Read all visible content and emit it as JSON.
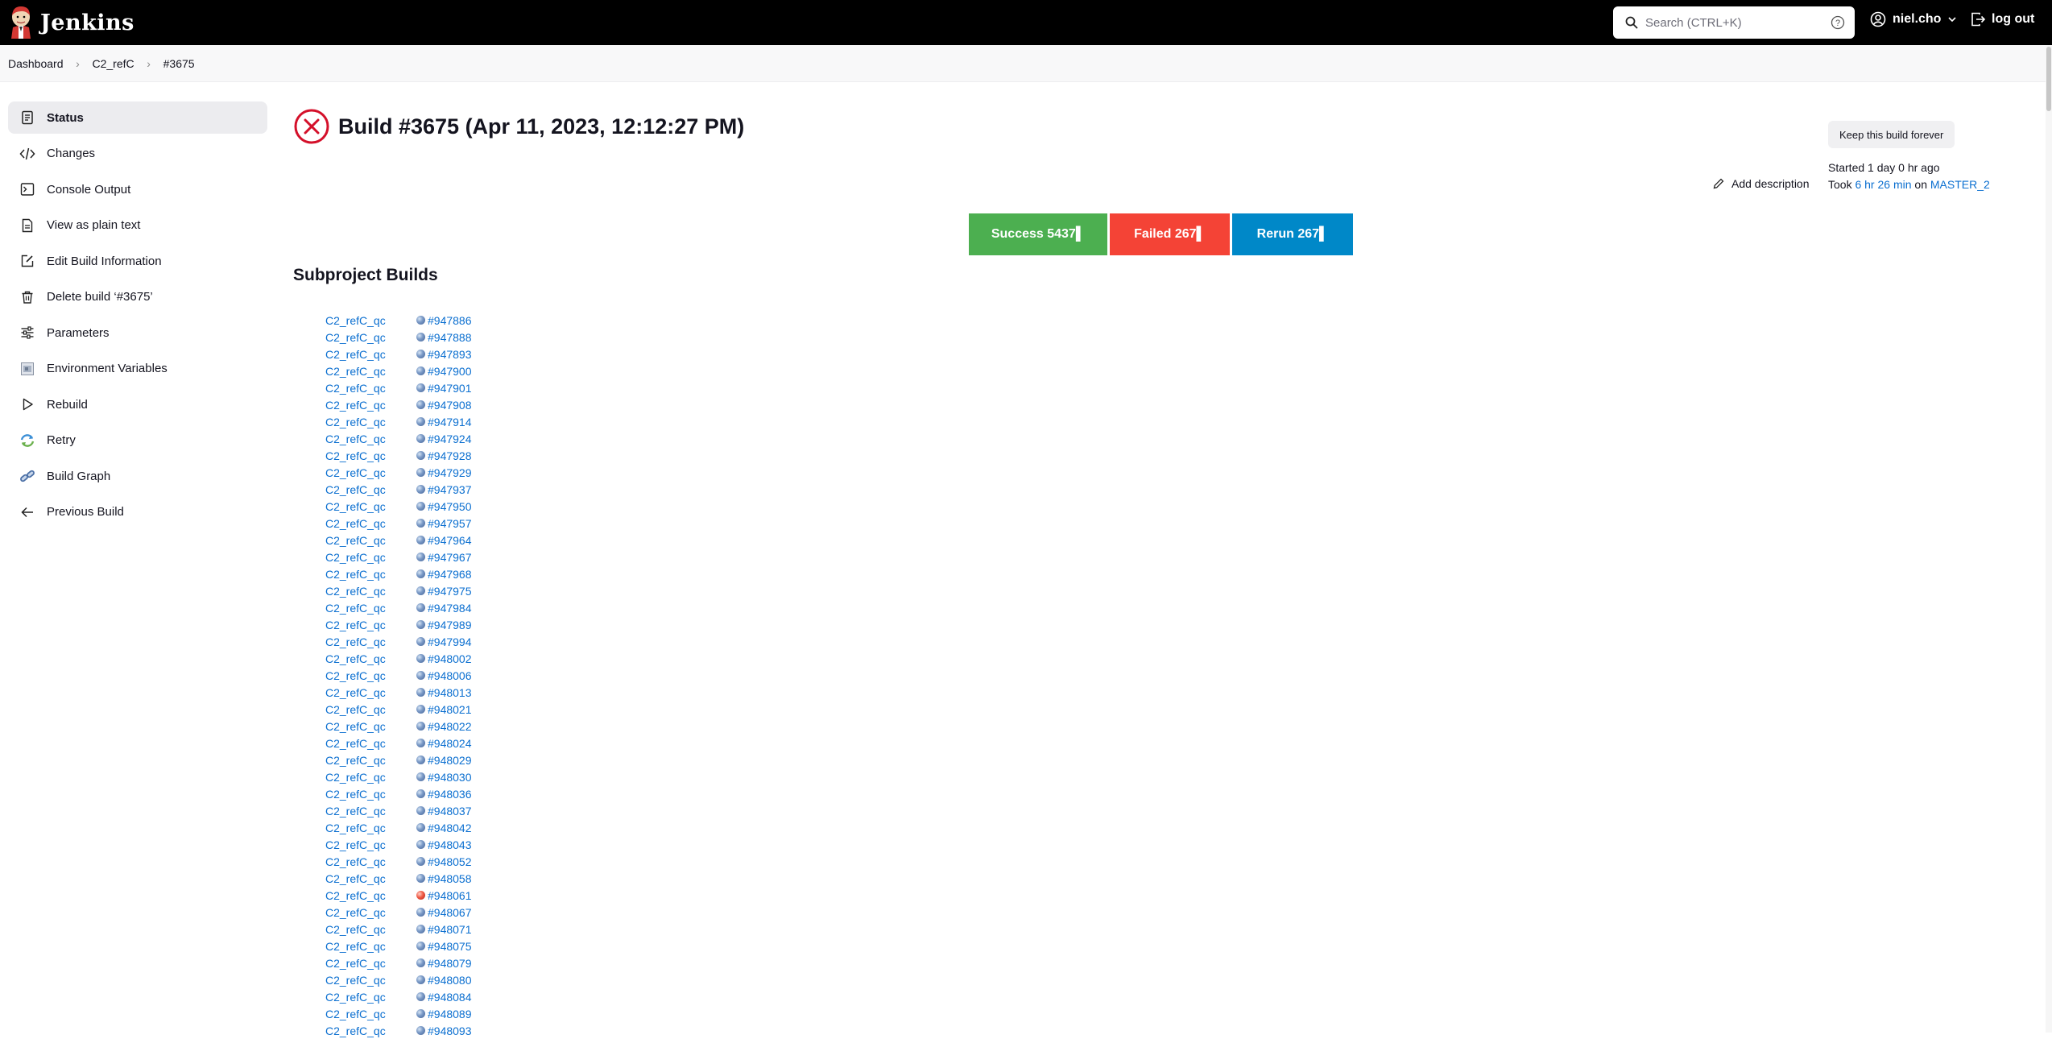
{
  "header": {
    "app_name": "Jenkins",
    "search_placeholder": "Search (CTRL+K)",
    "user_name": "niel.cho",
    "logout_label": "log out"
  },
  "breadcrumb": [
    "Dashboard",
    "C2_refC",
    "#3675"
  ],
  "sidebar": {
    "items": [
      {
        "label": "Status",
        "icon": "status-doc-icon",
        "active": true
      },
      {
        "label": "Changes",
        "icon": "code-icon"
      },
      {
        "label": "Console Output",
        "icon": "terminal-icon"
      },
      {
        "label": "View as plain text",
        "icon": "document-icon"
      },
      {
        "label": "Edit Build Information",
        "icon": "edit-icon"
      },
      {
        "label": "Delete build ‘#3675’",
        "icon": "trash-icon"
      },
      {
        "label": "Parameters",
        "icon": "sliders-icon"
      },
      {
        "label": "Environment Variables",
        "icon": "env-vars-icon"
      },
      {
        "label": "Rebuild",
        "icon": "play-icon"
      },
      {
        "label": "Retry",
        "icon": "retry-icon"
      },
      {
        "label": "Build Graph",
        "icon": "link-icon"
      },
      {
        "label": "Previous Build",
        "icon": "arrow-left-icon"
      }
    ]
  },
  "build": {
    "title": "Build #3675 (Apr 11, 2023, 12:12:27 PM)",
    "keep_label": "Keep this build forever",
    "started": "Started 1 day 0 hr ago",
    "took_prefix": "Took ",
    "duration": "6 hr 26 min",
    "on_word": " on ",
    "node": "MASTER_2",
    "add_description": "Add description"
  },
  "summary": {
    "success": "Success 5437▌",
    "failed": "Failed 267▌",
    "rerun": "Rerun 267▌"
  },
  "subprojects": {
    "title": "Subproject Builds",
    "rows": [
      {
        "job": "C2_refC_qc",
        "build": "#947886",
        "status": "blue"
      },
      {
        "job": "C2_refC_qc",
        "build": "#947888",
        "status": "blue"
      },
      {
        "job": "C2_refC_qc",
        "build": "#947893",
        "status": "blue"
      },
      {
        "job": "C2_refC_qc",
        "build": "#947900",
        "status": "blue"
      },
      {
        "job": "C2_refC_qc",
        "build": "#947901",
        "status": "blue"
      },
      {
        "job": "C2_refC_qc",
        "build": "#947908",
        "status": "blue"
      },
      {
        "job": "C2_refC_qc",
        "build": "#947914",
        "status": "blue"
      },
      {
        "job": "C2_refC_qc",
        "build": "#947924",
        "status": "blue"
      },
      {
        "job": "C2_refC_qc",
        "build": "#947928",
        "status": "blue"
      },
      {
        "job": "C2_refC_qc",
        "build": "#947929",
        "status": "blue"
      },
      {
        "job": "C2_refC_qc",
        "build": "#947937",
        "status": "blue"
      },
      {
        "job": "C2_refC_qc",
        "build": "#947950",
        "status": "blue"
      },
      {
        "job": "C2_refC_qc",
        "build": "#947957",
        "status": "blue"
      },
      {
        "job": "C2_refC_qc",
        "build": "#947964",
        "status": "blue"
      },
      {
        "job": "C2_refC_qc",
        "build": "#947967",
        "status": "blue"
      },
      {
        "job": "C2_refC_qc",
        "build": "#947968",
        "status": "blue"
      },
      {
        "job": "C2_refC_qc",
        "build": "#947975",
        "status": "blue"
      },
      {
        "job": "C2_refC_qc",
        "build": "#947984",
        "status": "blue"
      },
      {
        "job": "C2_refC_qc",
        "build": "#947989",
        "status": "blue"
      },
      {
        "job": "C2_refC_qc",
        "build": "#947994",
        "status": "blue"
      },
      {
        "job": "C2_refC_qc",
        "build": "#948002",
        "status": "blue"
      },
      {
        "job": "C2_refC_qc",
        "build": "#948006",
        "status": "blue"
      },
      {
        "job": "C2_refC_qc",
        "build": "#948013",
        "status": "blue"
      },
      {
        "job": "C2_refC_qc",
        "build": "#948021",
        "status": "blue"
      },
      {
        "job": "C2_refC_qc",
        "build": "#948022",
        "status": "blue"
      },
      {
        "job": "C2_refC_qc",
        "build": "#948024",
        "status": "blue"
      },
      {
        "job": "C2_refC_qc",
        "build": "#948029",
        "status": "blue"
      },
      {
        "job": "C2_refC_qc",
        "build": "#948030",
        "status": "blue"
      },
      {
        "job": "C2_refC_qc",
        "build": "#948036",
        "status": "blue"
      },
      {
        "job": "C2_refC_qc",
        "build": "#948037",
        "status": "blue"
      },
      {
        "job": "C2_refC_qc",
        "build": "#948042",
        "status": "blue"
      },
      {
        "job": "C2_refC_qc",
        "build": "#948043",
        "status": "blue"
      },
      {
        "job": "C2_refC_qc",
        "build": "#948052",
        "status": "blue"
      },
      {
        "job": "C2_refC_qc",
        "build": "#948058",
        "status": "blue"
      },
      {
        "job": "C2_refC_qc",
        "build": "#948061",
        "status": "red"
      },
      {
        "job": "C2_refC_qc",
        "build": "#948067",
        "status": "blue"
      },
      {
        "job": "C2_refC_qc",
        "build": "#948071",
        "status": "blue"
      },
      {
        "job": "C2_refC_qc",
        "build": "#948075",
        "status": "blue"
      },
      {
        "job": "C2_refC_qc",
        "build": "#948079",
        "status": "blue"
      },
      {
        "job": "C2_refC_qc",
        "build": "#948080",
        "status": "blue"
      },
      {
        "job": "C2_refC_qc",
        "build": "#948084",
        "status": "blue"
      },
      {
        "job": "C2_refC_qc",
        "build": "#948089",
        "status": "blue"
      },
      {
        "job": "C2_refC_qc",
        "build": "#948093",
        "status": "blue"
      }
    ]
  },
  "colors": {
    "link": "#0b6fd0",
    "success": "#4caf50",
    "failed": "#f44336",
    "rerun": "#0088c8",
    "fail_icon": "#d4102a"
  }
}
